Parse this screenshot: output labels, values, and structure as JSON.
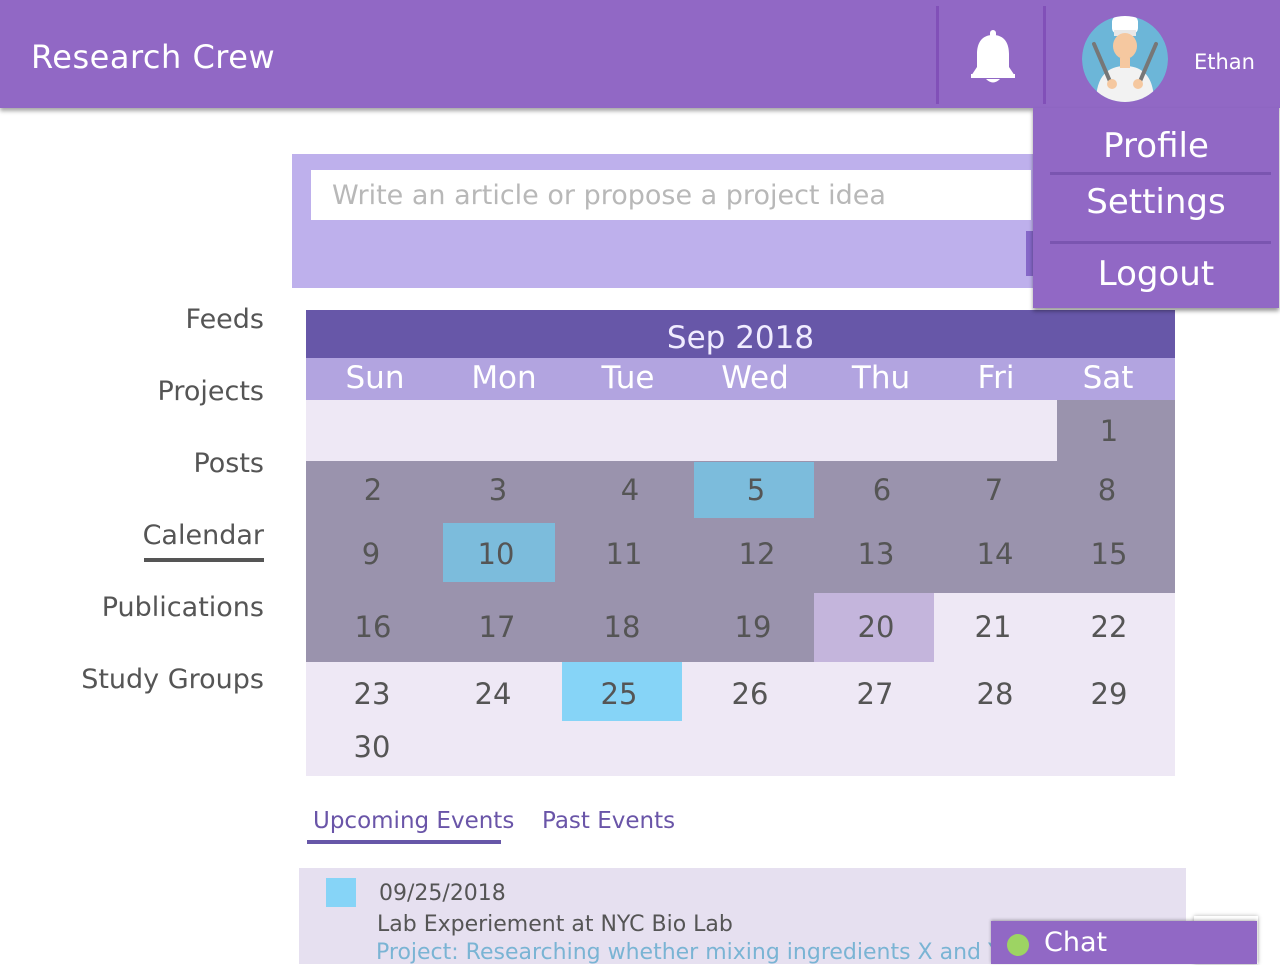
{
  "header": {
    "app_title": "Research Crew",
    "user_name": "Ethan"
  },
  "user_menu": {
    "items": [
      "Profile",
      "Settings",
      "Logout"
    ]
  },
  "composer": {
    "placeholder": "Write an article or propose a project idea"
  },
  "sidebar": {
    "items": [
      {
        "label": "Feeds"
      },
      {
        "label": "Projects"
      },
      {
        "label": "Posts"
      },
      {
        "label": "Calendar",
        "active": true
      },
      {
        "label": "Publications"
      },
      {
        "label": "Study Groups"
      }
    ]
  },
  "calendar": {
    "month_label": "Sep 2018",
    "day_names": [
      "Sun",
      "Mon",
      "Tue",
      "Wed",
      "Thu",
      "Fri",
      "Sat"
    ],
    "dates": [
      "1",
      "2",
      "3",
      "4",
      "5",
      "6",
      "7",
      "8",
      "9",
      "10",
      "11",
      "12",
      "13",
      "14",
      "15",
      "16",
      "17",
      "18",
      "19",
      "20",
      "21",
      "22",
      "23",
      "24",
      "25",
      "26",
      "27",
      "28",
      "29",
      "30"
    ],
    "past_through": 19,
    "today": 20,
    "event_days": [
      5,
      10,
      25
    ],
    "colors": {
      "header": "#6757a8",
      "weekday_bar": "#b2a4e0",
      "past": "#9a93ad",
      "future": "#eee8f5",
      "event_past": "#7cbcdc",
      "event_upcoming": "#86d4f7",
      "today": "#c4b5dc"
    }
  },
  "events": {
    "tabs": [
      "Upcoming Events",
      "Past Events"
    ],
    "active_tab": "Upcoming Events",
    "items": [
      {
        "date": "09/25/2018",
        "title": "Lab Experiement at NYC Bio Lab",
        "project": "Project: Researching whether mixing ingredients X and Y at"
      }
    ]
  },
  "chat": {
    "label": "Chat",
    "status_color": "#9dd463"
  },
  "icons": {
    "notifications": "bell-icon",
    "avatar": "chef-avatar-icon"
  }
}
